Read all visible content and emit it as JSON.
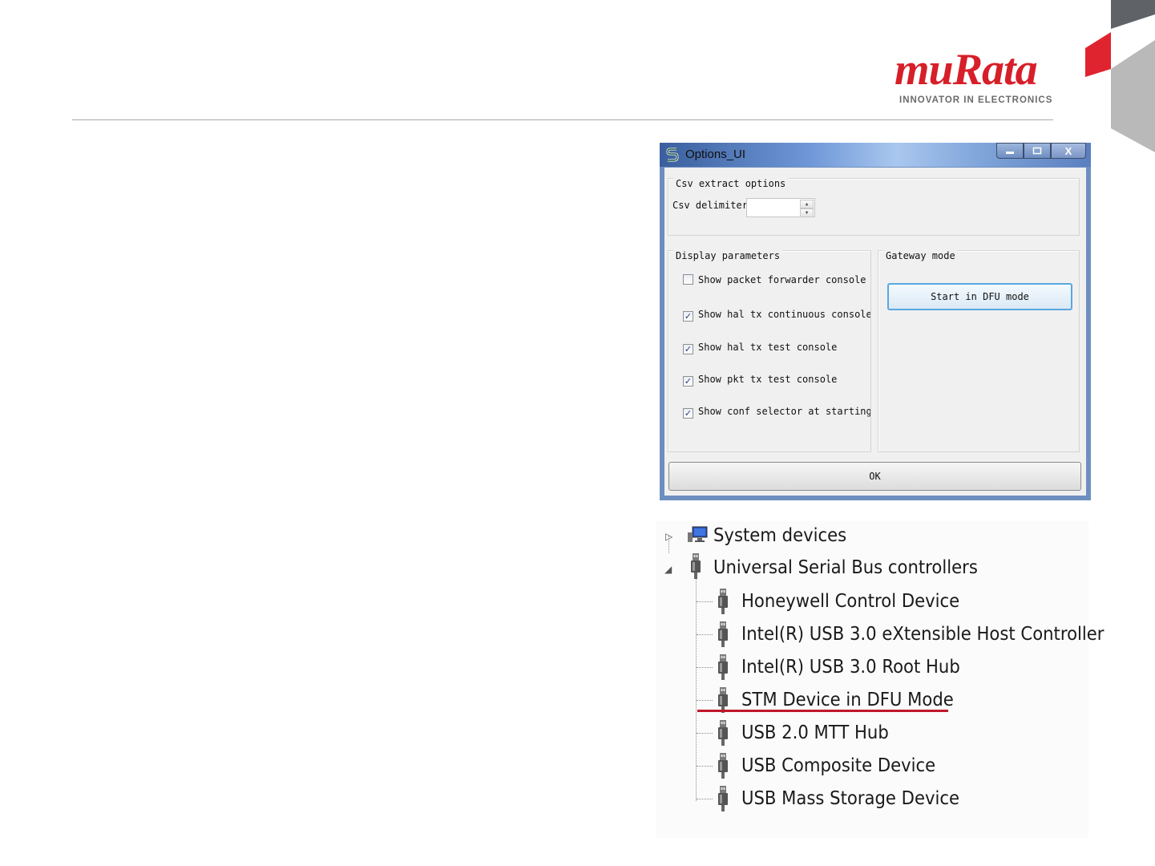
{
  "brand": {
    "name": "muRata",
    "tagline": "INNOVATOR IN ELECTRONICS",
    "color": "#d71f29"
  },
  "dialog": {
    "title": "Options_UI",
    "window_buttons": [
      "minimize-icon",
      "maximize-icon",
      "close-icon"
    ],
    "close_glyph": "X",
    "csv_group": {
      "title": "Csv extract options",
      "delimiter_label": "Csv delimiter",
      "delimiter_value": ""
    },
    "display_group": {
      "title": "Display parameters",
      "options": [
        {
          "label": "Show packet forwarder console",
          "checked": false
        },
        {
          "label": "Show hal tx continuous console",
          "checked": true
        },
        {
          "label": "Show hal tx test console",
          "checked": true
        },
        {
          "label": "Show pkt tx test console",
          "checked": true
        },
        {
          "label": "Show conf selector at starting",
          "checked": true
        }
      ]
    },
    "gateway_group": {
      "title": "Gateway mode",
      "dfu_button": "Start in DFU mode"
    },
    "ok_button": "OK"
  },
  "device_tree": {
    "categories": [
      {
        "label": "System devices",
        "expanded": false
      },
      {
        "label": "Universal Serial Bus controllers",
        "expanded": true
      }
    ],
    "usb_devices": [
      "Honeywell Control Device",
      "Intel(R) USB 3.0 eXtensible Host Controller",
      "Intel(R) USB 3.0 Root Hub",
      "STM Device in DFU Mode",
      "USB 2.0 MTT Hub",
      "USB Composite Device",
      "USB Mass Storage Device"
    ],
    "highlighted_device": "STM Device in DFU Mode",
    "highlight_color": "#c0172a"
  }
}
